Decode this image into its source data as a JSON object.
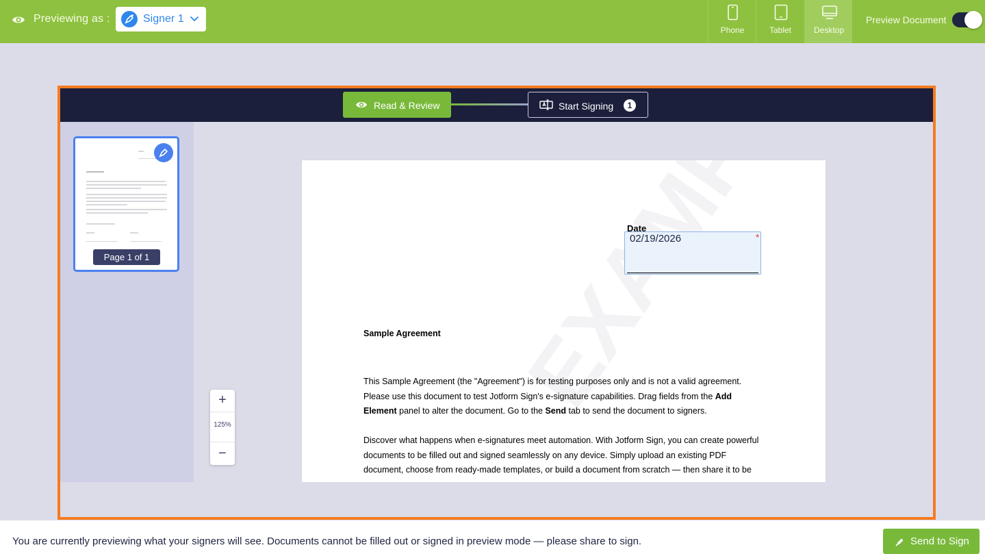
{
  "topbar": {
    "previewing_label": "Previewing as :",
    "signer": "Signer 1",
    "devices": [
      {
        "label": "Phone",
        "icon": "phone-icon"
      },
      {
        "label": "Tablet",
        "icon": "tablet-icon"
      },
      {
        "label": "Desktop",
        "icon": "desktop-icon",
        "active": true
      }
    ],
    "preview_document_label": "Preview Document",
    "preview_document_on": true
  },
  "steps": {
    "review_label": "Read & Review",
    "sign_label": "Start Signing",
    "sign_count": "1"
  },
  "thumbnail": {
    "page_label": "Page 1 of 1"
  },
  "document": {
    "watermark": "EXAMPLE PDF",
    "date_label": "Date",
    "date_value": "02/19/2026",
    "required_mark": "*",
    "title": "Sample Agreement",
    "para1_a": "This Sample Agreement (the \"Agreement\") is for testing purposes only and is not a valid agreement. Please use this document to test Jotform Sign's e-signature capabilities. Drag fields from the ",
    "para1_b": "Add Element",
    "para1_c": " panel to alter the document. Go to the ",
    "para1_d": "Send",
    "para1_e": " tab to send the document to signers.",
    "para2": "Discover what happens when e-signatures meet automation. With Jotform Sign, you can create powerful documents to be filled out and signed seamlessly on any device. Simply upload an existing PDF document, choose from ready-made templates, or build a document from scratch — then share it to be"
  },
  "zoom": {
    "in_label": "+",
    "value": "125%",
    "out_label": "−"
  },
  "bottom": {
    "message": "You are currently previewing what your signers will see. Documents cannot be filled out or signed in preview mode — please share to sign.",
    "send_label": "Send to Sign"
  },
  "colors": {
    "topbar": "#8ec13f",
    "accent_green": "#78b93a",
    "frame_border": "#f47b20",
    "header_dark": "#1b1f3b",
    "signer_blue": "#2f86eb"
  }
}
